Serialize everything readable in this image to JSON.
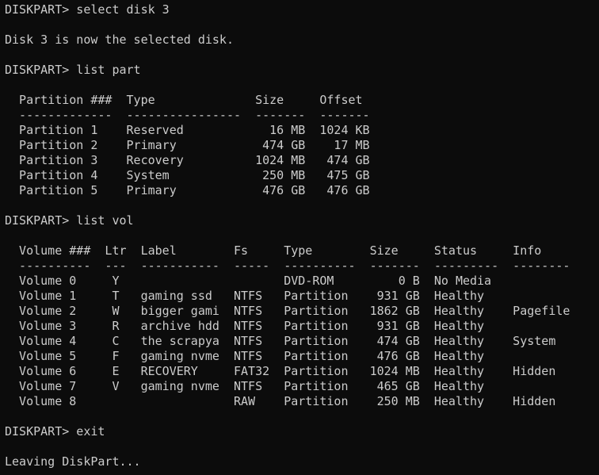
{
  "terminal": {
    "lines": [
      "DISKPART> select disk 3",
      "",
      "Disk 3 is now the selected disk.",
      "",
      "DISKPART> list part",
      "",
      "  Partition ###  Type              Size     Offset",
      "  -------------  ----------------  -------  -------",
      "  Partition 1    Reserved            16 MB  1024 KB",
      "  Partition 2    Primary            474 GB    17 MB",
      "  Partition 3    Recovery          1024 MB   474 GB",
      "  Partition 4    System             250 MB   475 GB",
      "  Partition 5    Primary            476 GB   476 GB",
      "",
      "DISKPART> list vol",
      "",
      "  Volume ###  Ltr  Label        Fs     Type        Size     Status     Info",
      "  ----------  ---  -----------  -----  ----------  -------  ---------  --------",
      "  Volume 0     Y                       DVD-ROM         0 B  No Media",
      "  Volume 1     T   gaming ssd   NTFS   Partition    931 GB  Healthy",
      "  Volume 2     W   bigger gami  NTFS   Partition   1862 GB  Healthy    Pagefile",
      "  Volume 3     R   archive hdd  NTFS   Partition    931 GB  Healthy",
      "  Volume 4     C   the scrapya  NTFS   Partition    474 GB  Healthy    System",
      "  Volume 5     F   gaming nvme  NTFS   Partition    476 GB  Healthy",
      "  Volume 6     E   RECOVERY     FAT32  Partition   1024 MB  Healthy    Hidden",
      "  Volume 7     V   gaming nvme  NTFS   Partition    465 GB  Healthy",
      "  Volume 8                      RAW    Partition    250 MB  Healthy    Hidden",
      "",
      "DISKPART> exit",
      "",
      "Leaving DiskPart..."
    ]
  }
}
